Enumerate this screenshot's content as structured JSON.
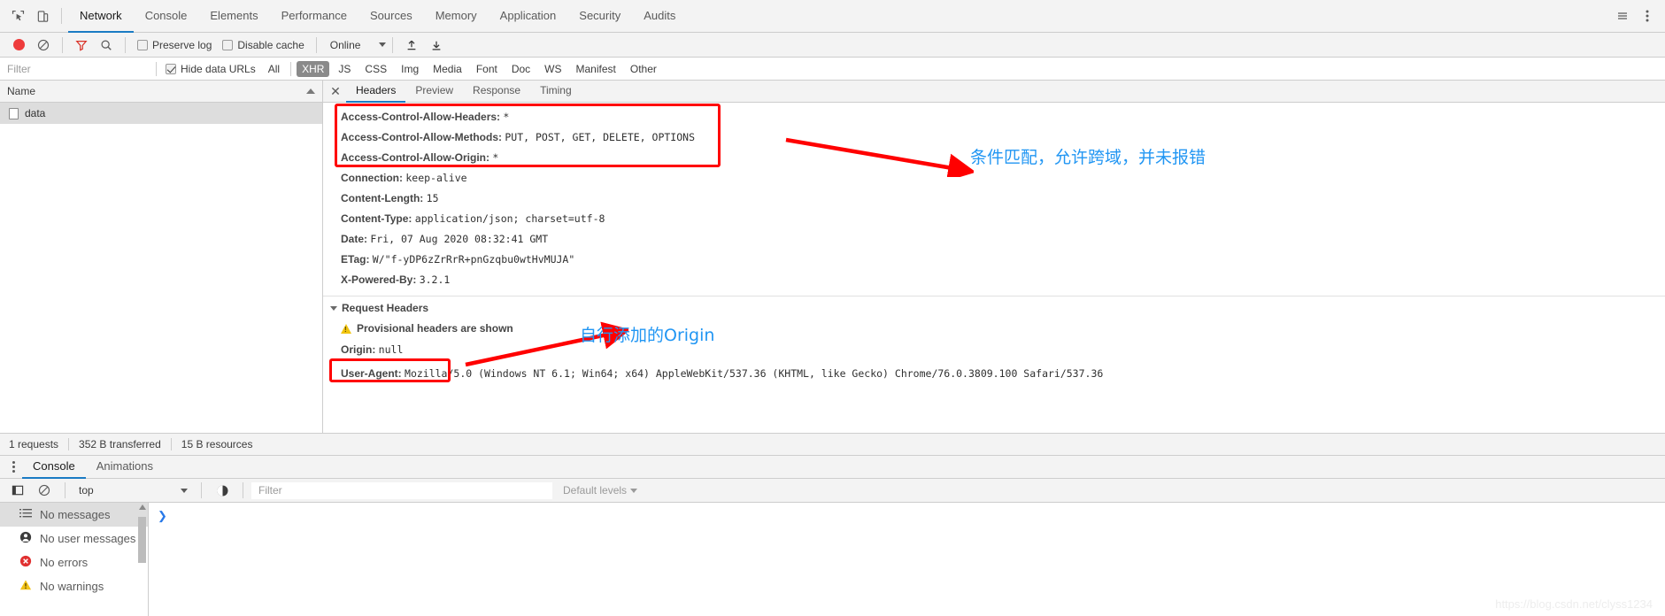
{
  "main_tabs": [
    {
      "label": "Network",
      "active": true
    },
    {
      "label": "Console",
      "active": false
    },
    {
      "label": "Elements",
      "active": false
    },
    {
      "label": "Performance",
      "active": false
    },
    {
      "label": "Sources",
      "active": false
    },
    {
      "label": "Memory",
      "active": false
    },
    {
      "label": "Application",
      "active": false
    },
    {
      "label": "Security",
      "active": false
    },
    {
      "label": "Audits",
      "active": false
    }
  ],
  "network_toolbar": {
    "record_tooltip": "record-button",
    "preserve_log_label": "Preserve log",
    "preserve_log_checked": false,
    "disable_cache_label": "Disable cache",
    "disable_cache_checked": false,
    "throttle_value": "Online"
  },
  "filter_bar": {
    "placeholder": "Filter",
    "value": "",
    "hide_data_urls_label": "Hide data URLs",
    "hide_data_urls_checked": true,
    "types": [
      {
        "label": "All",
        "active": false
      },
      {
        "label": "XHR",
        "active": true
      },
      {
        "label": "JS",
        "active": false
      },
      {
        "label": "CSS",
        "active": false
      },
      {
        "label": "Img",
        "active": false
      },
      {
        "label": "Media",
        "active": false
      },
      {
        "label": "Font",
        "active": false
      },
      {
        "label": "Doc",
        "active": false
      },
      {
        "label": "WS",
        "active": false
      },
      {
        "label": "Manifest",
        "active": false
      },
      {
        "label": "Other",
        "active": false
      }
    ]
  },
  "request_list": {
    "column_header": "Name",
    "rows": [
      {
        "name": "data",
        "selected": true
      }
    ]
  },
  "detail_tabs": [
    {
      "label": "Headers",
      "active": true
    },
    {
      "label": "Preview",
      "active": false
    },
    {
      "label": "Response",
      "active": false
    },
    {
      "label": "Timing",
      "active": false
    }
  ],
  "response_headers": [
    {
      "name": "Access-Control-Allow-Headers:",
      "value": "*"
    },
    {
      "name": "Access-Control-Allow-Methods:",
      "value": "PUT, POST, GET, DELETE, OPTIONS"
    },
    {
      "name": "Access-Control-Allow-Origin:",
      "value": "*"
    },
    {
      "name": "Connection:",
      "value": "keep-alive"
    },
    {
      "name": "Content-Length:",
      "value": "15"
    },
    {
      "name": "Content-Type:",
      "value": "application/json; charset=utf-8"
    },
    {
      "name": "Date:",
      "value": "Fri, 07 Aug 2020 08:32:41 GMT"
    },
    {
      "name": "ETag:",
      "value": "W/\"f-yDP6zZrRrR+pnGzqbu0wtHvMUJA\""
    },
    {
      "name": "X-Powered-By:",
      "value": "3.2.1"
    }
  ],
  "request_headers_section": {
    "title": "Request Headers",
    "provisional_warning": "Provisional headers are shown",
    "headers": [
      {
        "name": "Origin:",
        "value": "null"
      },
      {
        "name": "User-Agent:",
        "value": "Mozilla/5.0 (Windows NT 6.1; Win64; x64) AppleWebKit/537.36 (KHTML, like Gecko) Chrome/76.0.3809.100 Safari/537.36"
      }
    ]
  },
  "annotations": [
    {
      "id": "cors-note",
      "text": "条件匹配，允许跨域，并未报错",
      "color": "#2196f3"
    },
    {
      "id": "origin-note",
      "text": "自行添加的Origin",
      "color": "#2196f3"
    }
  ],
  "network_status": {
    "requests": "1 requests",
    "transferred": "352 B transferred",
    "resources": "15 B resources"
  },
  "drawer_tabs": [
    {
      "label": "Console",
      "active": true
    },
    {
      "label": "Animations",
      "active": false
    }
  ],
  "console_toolbar": {
    "context": "top",
    "filter_placeholder": "Filter",
    "filter_value": "",
    "levels_label": "Default levels"
  },
  "console_sidebar": [
    {
      "label": "No messages",
      "icon": "list-icon",
      "active": true
    },
    {
      "label": "No user messages",
      "icon": "user-icon",
      "active": false
    },
    {
      "label": "No errors",
      "icon": "error-icon",
      "active": false
    },
    {
      "label": "No warnings",
      "icon": "warning-icon",
      "active": false
    }
  ],
  "watermark": "https://blog.csdn.net/clyss1234",
  "colors": {
    "accent": "#1a7bc4",
    "annotation_red": "#ff0000",
    "annotation_blue": "#2196f3",
    "record_red": "#ee3b3b"
  }
}
